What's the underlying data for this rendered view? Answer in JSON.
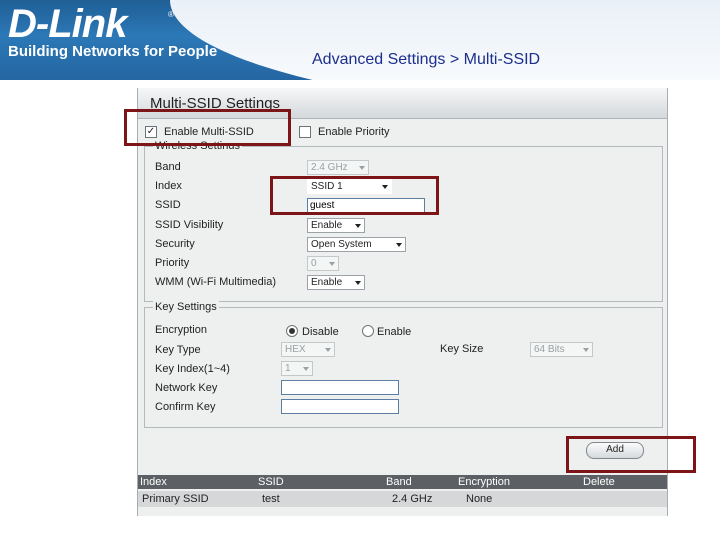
{
  "header": {
    "logo": "D-Link",
    "registered": "®",
    "tagline": "Building Networks for People",
    "breadcrumb": "Advanced Settings > Multi-SSID"
  },
  "panel": {
    "title": "Multi-SSID Settings",
    "enable_multi_ssid": {
      "label": "Enable Multi-SSID",
      "checked": true,
      "mark": "✓"
    },
    "enable_priority": {
      "label": "Enable Priority",
      "checked": false
    }
  },
  "wireless": {
    "legend": "Wireless Settings",
    "band_label": "Band",
    "band_value": "2.4 GHz",
    "index_label": "Index",
    "index_value": "SSID 1",
    "ssid_label": "SSID",
    "ssid_value": "guest",
    "visibility_label": "SSID Visibility",
    "visibility_value": "Enable",
    "security_label": "Security",
    "security_value": "Open System",
    "priority_label": "Priority",
    "priority_value": "0",
    "wmm_label": "WMM (Wi-Fi Multimedia)",
    "wmm_value": "Enable"
  },
  "key": {
    "legend": "Key Settings",
    "encryption_label": "Encryption",
    "disable_label": "Disable",
    "enable_label": "Enable",
    "selected": "Disable",
    "key_type_label": "Key Type",
    "key_type_value": "HEX",
    "key_size_label": "Key Size",
    "key_size_value": "64 Bits",
    "key_index_label": "Key Index(1~4)",
    "key_index_value": "1",
    "network_key_label": "Network Key",
    "network_key_value": "",
    "confirm_key_label": "Confirm Key",
    "confirm_key_value": ""
  },
  "add_button": "Add",
  "table": {
    "headers": [
      "Index",
      "SSID",
      "Band",
      "Encryption",
      "Delete"
    ],
    "rows": [
      {
        "index": "Primary SSID",
        "ssid": "test",
        "band": "2.4 GHz",
        "encryption": "None",
        "delete": ""
      }
    ]
  },
  "colors": {
    "highlight": "#7c1418",
    "brand_blue": "#2466a2",
    "breadcrumb": "#1c2f8e"
  }
}
